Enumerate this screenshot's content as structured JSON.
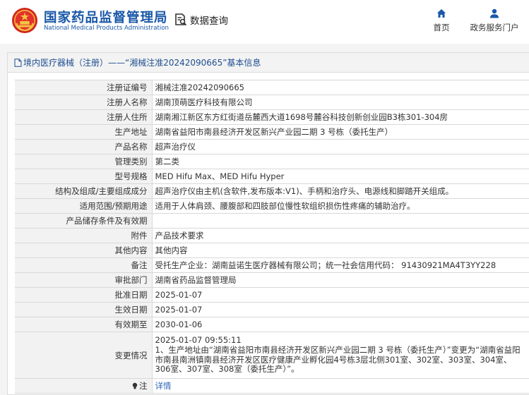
{
  "site": {
    "name_cn": "国家药品监督管理局",
    "name_en": "National Medical Products Administration",
    "query_label": "数据查询"
  },
  "nav": {
    "home": "首页",
    "services": "政务服务门户"
  },
  "breadcrumb": "境内医疗器械（注册）——“湘械注准20242090665”基本信息",
  "record": {
    "rows": [
      {
        "label": "注册证编号",
        "value": "湘械注准20242090665"
      },
      {
        "label": "注册人名称",
        "value": "湖南顶萌医疗科技有限公司"
      },
      {
        "label": "注册人住所",
        "value": "湖南湘江新区东方红街道岳麓西大道1698号麓谷科技创新创业园B3栋301-304房"
      },
      {
        "label": "生产地址",
        "value": "湖南省益阳市南县经济开发区新兴产业园二期 3 号栋（委托生产）"
      },
      {
        "label": "产品名称",
        "value": "超声治疗仪"
      },
      {
        "label": "管理类别",
        "value": "第二类"
      },
      {
        "label": "型号规格",
        "value": "MED Hifu Max、MED Hifu Hyper"
      },
      {
        "label": "结构及组成/主要组成成分",
        "value": "超声治疗仪由主机(含软件,发布版本:V1)、手柄和治疗头、电源线和脚踏开关组成。"
      },
      {
        "label": "适用范围/预期用途",
        "value": "适用于人体肩颈、腰腹部和四肢部位慢性软组织损伤性疼痛的辅助治疗。"
      },
      {
        "label": "产品储存条件及有效期",
        "value": ""
      },
      {
        "label": "附件",
        "value": "产品技术要求"
      },
      {
        "label": "其他内容",
        "value": "其他内容"
      },
      {
        "label": "备注",
        "value": "受托生产企业：湖南益诺生医疗器械有限公司；统一社会信用代码： 91430921MA4T3YY228"
      },
      {
        "label": "审批部门",
        "value": "湖南省药品监督管理局"
      },
      {
        "label": "批准日期",
        "value": "2025-01-07"
      },
      {
        "label": "生效日期",
        "value": "2025-01-07"
      },
      {
        "label": "有效期至",
        "value": "2030-01-06"
      }
    ],
    "change": {
      "label": "变更情况",
      "time": "2025-01-07 09:55:11",
      "text": "1、生产地址由“湖南省益阳市南县经济开发区新兴产业园二期 3 号栋（委托生产）”变更为“湖南省益阳市南县南洲镇南县经济开发区医疗健康产业孵化园4号栋3层北侧301室、302室、303室、304室、306室、307室、308室（委托生产）”。"
    },
    "note": {
      "label": "注",
      "link": "详情"
    }
  },
  "colors": {
    "brand": "#1a58a8",
    "link": "#2a62b8"
  }
}
